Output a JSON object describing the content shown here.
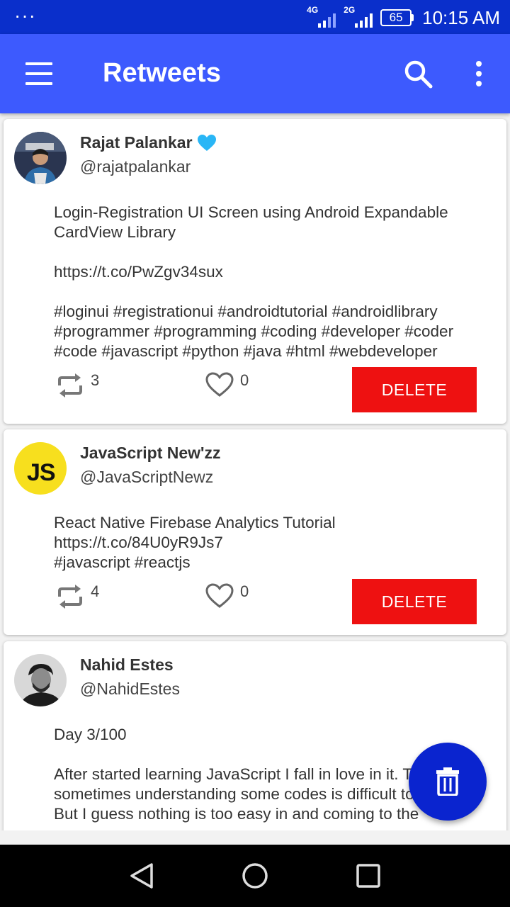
{
  "status_bar": {
    "dots": "···",
    "network_1": "4G",
    "network_2": "2G",
    "battery": "65",
    "time": "10:15 AM"
  },
  "app_bar": {
    "title": "Retweets",
    "menu_icon": "hamburger-menu-icon",
    "search_icon": "search-icon",
    "more_icon": "more-vert-icon"
  },
  "tweets": [
    {
      "name": "Rajat Palankar",
      "verified": true,
      "handle": "@rajatpalankar",
      "paragraphs": [
        "Login-Registration UI Screen using Android Expandable CardView Library",
        "https://t.co/PwZgv34sux",
        "#loginui #registrationui #androidtutorial #androidlibrary #programmer #programming #coding #developer #coder #code #javascript #python #java #html #webdeveloper"
      ],
      "retweets": "3",
      "likes": "0",
      "delete_label": "DELETE"
    },
    {
      "name": "JavaScript New'zz",
      "verified": false,
      "handle": "@JavaScriptNewz",
      "paragraphs": [
        "React Native Firebase Analytics Tutorial\nhttps://t.co/84U0yR9Js7\n#javascript #reactjs"
      ],
      "avatar_text": "JS",
      "retweets": "4",
      "likes": "0",
      "delete_label": "DELETE"
    },
    {
      "name": "Nahid Estes",
      "verified": false,
      "handle": "@NahidEstes",
      "paragraphs": [
        "Day 3/100",
        "After started learning JavaScript I fall in love in it. Though, sometimes understanding some codes is difficult to me.\nBut I guess nothing is too easy in and coming to the"
      ]
    }
  ],
  "fab": {
    "icon": "trash-icon"
  },
  "nav": {
    "back_icon": "back-triangle-icon",
    "home_icon": "home-circle-icon",
    "recents_icon": "recents-square-icon"
  },
  "colors": {
    "status_bar": "#0a2fcb",
    "app_bar": "#3d5afe",
    "delete": "#ee1111",
    "fab": "#0a24cf",
    "verified": "#29b6f6",
    "js_yellow": "#f7df1e"
  }
}
